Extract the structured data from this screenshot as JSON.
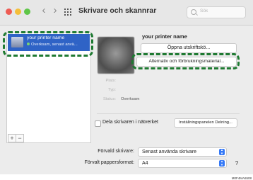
{
  "window": {
    "title": "Skrivare och skannrar",
    "nav_back": "‹",
    "nav_forward": "›",
    "search_placeholder": "Sök"
  },
  "printer_list": {
    "items": [
      {
        "name": "your printer name",
        "status": "Overksam, senast anvä..."
      }
    ],
    "add_label": "+",
    "remove_label": "−"
  },
  "details": {
    "printer_name": "your printer name",
    "open_queue_button": "Öppna utskriftskö...",
    "options_button": "Alternativ och förbrukningsmaterial...",
    "fields": [
      {
        "label": "Plats:",
        "value": ""
      },
      {
        "label": "Typ:",
        "value": ""
      },
      {
        "label": "Status:",
        "value": "Overksam"
      }
    ],
    "share_label": "Dela skrivaren i nätverket",
    "sharing_prefs_button": "Inställningspanelen Delning..."
  },
  "defaults": {
    "default_printer_label": "Förvald skrivare:",
    "default_printer_value": "Senast använda skrivare",
    "default_paper_label": "Förvalt pappersformat:",
    "default_paper_value": "A4",
    "help_label": "?"
  },
  "caption": "M0F4MA6508",
  "colors": {
    "selection": "#2f63c6",
    "highlight_dash": "#1f7a32",
    "accent": "#3478f6"
  }
}
